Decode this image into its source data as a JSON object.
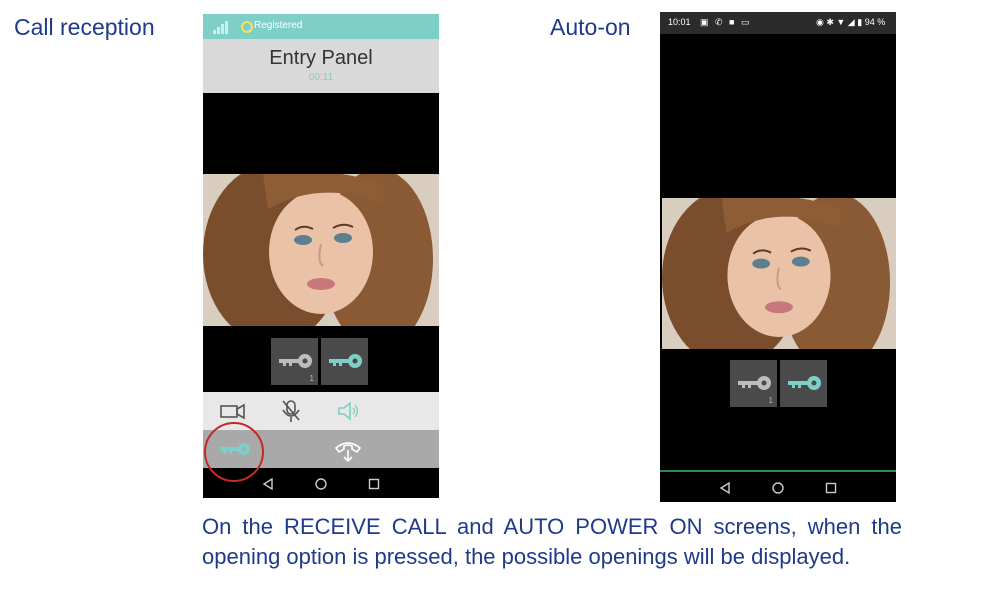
{
  "captions": {
    "left": "Call reception",
    "right": "Auto-on"
  },
  "phone1": {
    "status_text": "Registered",
    "title": "Entry Panel",
    "timer": "00:11",
    "door_tiles": [
      {
        "icon": "key-icon",
        "number": "1",
        "color": "#bdbdbd"
      },
      {
        "icon": "key-icon",
        "number": "",
        "color": "#7dcfc8"
      }
    ],
    "tools": [
      "camera-icon",
      "microphone-muted-icon",
      "speaker-icon"
    ],
    "actions": [
      "open-door-key-icon",
      "hang-up-icon"
    ]
  },
  "phone2": {
    "status_time": "10:01",
    "status_right": "94 %",
    "door_tiles": [
      {
        "icon": "key-icon",
        "number": "1",
        "color": "#bdbdbd"
      },
      {
        "icon": "key-icon",
        "number": "",
        "color": "#7dcfc8"
      }
    ]
  },
  "footer": "On the RECEIVE CALL and AUTO POWER ON screens, when the opening option is pressed, the possible openings will be displayed.",
  "colors": {
    "accent_teal": "#7dcfc8",
    "caption_blue": "#1f3a8a",
    "highlight_red": "#c62828"
  }
}
